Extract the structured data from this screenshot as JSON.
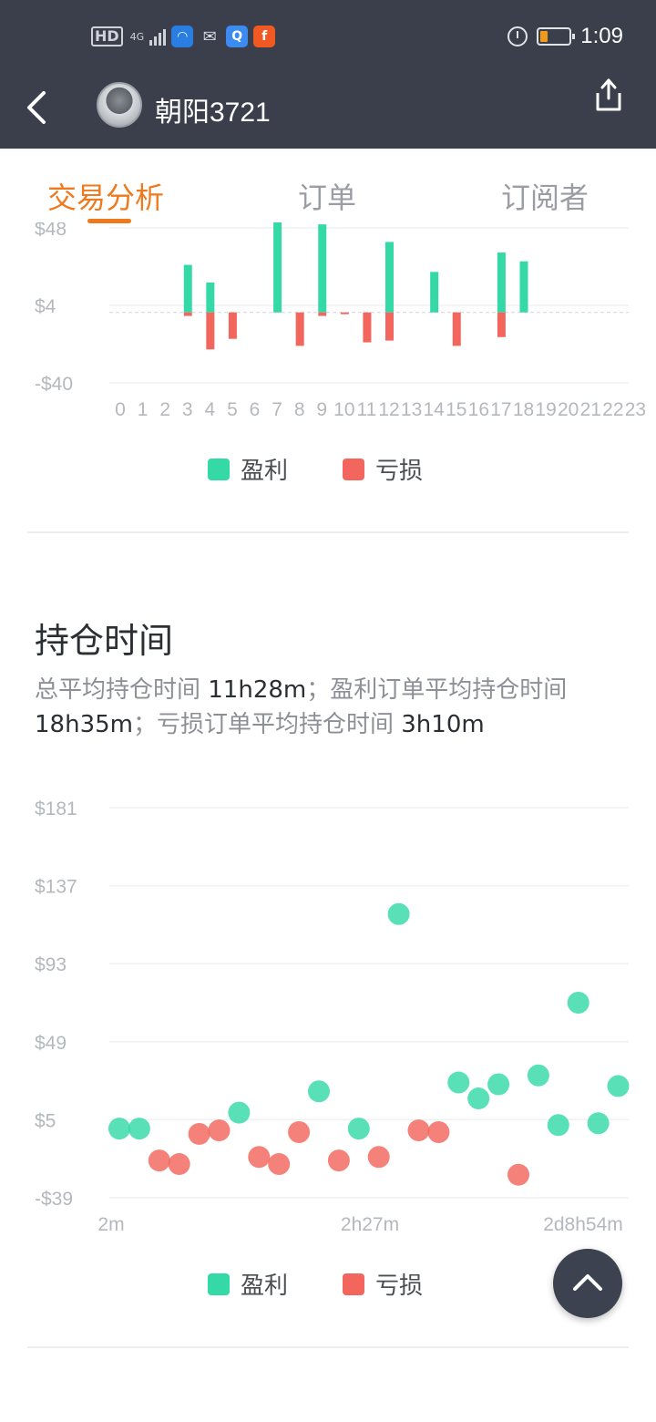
{
  "status_bar": {
    "hd": "HD",
    "network": "4G",
    "time": "1:09"
  },
  "header": {
    "back_icon": "chevron-left-icon",
    "username": "朝阳3721",
    "share_icon": "share-icon"
  },
  "tabs": [
    {
      "label": "交易分析",
      "active": true
    },
    {
      "label": "订单",
      "active": false
    },
    {
      "label": "订阅者",
      "active": false
    }
  ],
  "colors": {
    "profit": "#35d9a6",
    "loss": "#f2665e",
    "accent": "#ef7a1e",
    "header_bg": "#3a3f4b"
  },
  "hourly_chart": {
    "legend": {
      "profit": "盈利",
      "loss": "亏损"
    }
  },
  "holding_time": {
    "title": "持仓时间",
    "summary_parts": [
      {
        "text": "总平均持仓时间 ",
        "type": "label"
      },
      {
        "text": "11h28m",
        "type": "val"
      },
      {
        "text": "；盈利订单平均持仓时间 ",
        "type": "label"
      },
      {
        "text": "18h35m",
        "type": "val"
      },
      {
        "text": "；亏损订单平均持仓时间 ",
        "type": "label"
      },
      {
        "text": "3h10m",
        "type": "val"
      }
    ],
    "legend": {
      "profit": "盈利",
      "loss": "亏损"
    }
  },
  "chart_data": [
    {
      "type": "bar",
      "categories": [
        "0",
        "1",
        "2",
        "3",
        "4",
        "5",
        "6",
        "7",
        "8",
        "9",
        "10",
        "11",
        "12",
        "13",
        "14",
        "15",
        "16",
        "17",
        "18",
        "19",
        "20",
        "21",
        "22",
        "23"
      ],
      "y_ticks": [
        "$48",
        "$4",
        "-$40"
      ],
      "ylim": [
        -40,
        48
      ],
      "series": [
        {
          "name": "盈利",
          "values": [
            0,
            0,
            0,
            27,
            17,
            0,
            0,
            52,
            0,
            50,
            0,
            0,
            40,
            0,
            23,
            0,
            0,
            34,
            29,
            0,
            0,
            0,
            0,
            0
          ]
        },
        {
          "name": "亏损",
          "values": [
            0,
            0,
            0,
            -2,
            -21,
            -15,
            0,
            0,
            -19,
            -2,
            -1,
            -17,
            -16,
            0,
            0,
            -19,
            0,
            -14,
            0,
            0,
            0,
            0,
            0,
            0
          ]
        }
      ]
    },
    {
      "type": "scatter",
      "x_ticks": [
        "2m",
        "2h27m",
        "2d8h54m"
      ],
      "y_ticks": [
        "$181",
        "$137",
        "$93",
        "$49",
        "$5",
        "-$39"
      ],
      "ylim": [
        -39,
        181
      ],
      "series": [
        {
          "name": "盈利",
          "points": [
            [
              1,
              0
            ],
            [
              2,
              0
            ],
            [
              7,
              9
            ],
            [
              11,
              21
            ],
            [
              13,
              0
            ],
            [
              15,
              121
            ],
            [
              18,
              26
            ],
            [
              19,
              17
            ],
            [
              20,
              25
            ],
            [
              22,
              30
            ],
            [
              23,
              2
            ],
            [
              24,
              71
            ],
            [
              25,
              3
            ],
            [
              26,
              24
            ]
          ]
        },
        {
          "name": "亏损",
          "points": [
            [
              3,
              -18
            ],
            [
              4,
              -20
            ],
            [
              5,
              -3
            ],
            [
              6,
              -1
            ],
            [
              8,
              -16
            ],
            [
              9,
              -20
            ],
            [
              10,
              -2
            ],
            [
              12,
              -18
            ],
            [
              14,
              -16
            ],
            [
              16,
              -1
            ],
            [
              17,
              -2
            ],
            [
              21,
              -26
            ]
          ]
        }
      ]
    }
  ]
}
